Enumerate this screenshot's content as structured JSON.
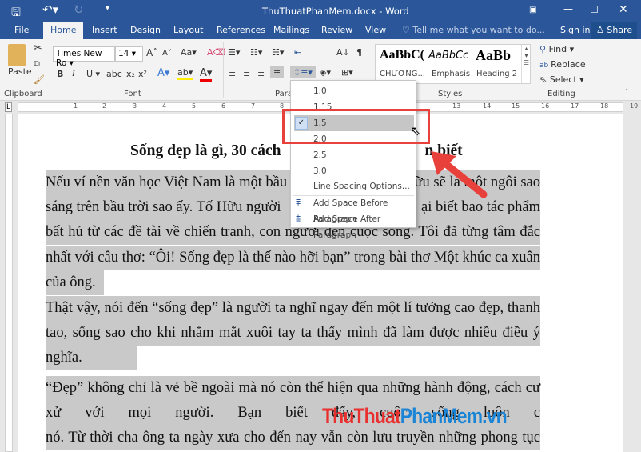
{
  "title": "ThuThuatPhanMem.docx - Word",
  "tabs": [
    "File",
    "Home",
    "Insert",
    "Design",
    "Layout",
    "References",
    "Mailings",
    "Review",
    "View"
  ],
  "tell_me": "Tell me what you want to do...",
  "sign_in": "Sign in",
  "share": "Share",
  "font": {
    "name": "Times New Ro",
    "size": "14"
  },
  "clipboard": {
    "paste": "Paste"
  },
  "styles": [
    {
      "preview": "AaBbC(",
      "name": "CHƯƠNG..."
    },
    {
      "preview": "AaBbCc",
      "name": "Emphasis"
    },
    {
      "preview": "AaBb",
      "name": "Heading 2"
    }
  ],
  "editing": {
    "find": "Find",
    "replace": "Replace",
    "select": "Select"
  },
  "groups": {
    "clipboard": "Clipboard",
    "font": "Font",
    "paragraph": "Parag",
    "styles": "Styles",
    "editing": "Editing"
  },
  "ruler": [
    "1",
    "2",
    "3",
    "4",
    "5",
    "6",
    "7",
    "8",
    "13",
    "14",
    "15",
    "16",
    "17",
    "18",
    "19"
  ],
  "menu": {
    "options": [
      "1.0",
      "1.15",
      "1.5",
      "2.0",
      "2.5",
      "3.0"
    ],
    "selected": "1.5",
    "line_spacing_options": "Line Spacing Options...",
    "add_before": "Add Space Before Paragraph",
    "add_after": "Add Space After Paragraph"
  },
  "doc": {
    "title_left": "Sống đẹp là gì, 30 cách",
    "title_right": "n biết",
    "lines": [
      {
        "l": "Nếu ví nền văn học Việt Nam là một bầu",
        "r": "ữu sẽ là một ngôi sao"
      },
      {
        "l": "sáng trên bầu trời sao ấy. Tố Hữu người",
        "r": "ại biết bao tác phẩm"
      },
      {
        "l": "bất hủ từ các đề tài về chiến tranh, con người đến cuộc sống. Tôi đã từng tâm đắc",
        "r": ""
      },
      {
        "l": "nhất với câu thơ:  “Ôi! Sống đẹp là thế nào hỡi bạn” trong bài thơ Một khúc ca xuân",
        "r": ""
      },
      {
        "l": "của ông.",
        "r": ""
      },
      {
        "l": "Thật vậy, nói đến “sống đẹp” là người ta nghĩ ngay đến một lí tưởng cao đẹp, thanh",
        "r": ""
      },
      {
        "l": "tao, sống sao cho khi nhắm mắt xuôi tay ta thấy mình đã làm được nhiều điều ý",
        "r": ""
      },
      {
        "l": "nghĩa.",
        "r": ""
      },
      {
        "l": "“Đẹp” không chỉ là vẻ bề ngoài mà nó còn thể hiện qua những hành động, cách cư",
        "r": ""
      },
      {
        "l": "xử với mọi người. Bạn biết đấy, cuộc sống luôn c",
        "r": ""
      },
      {
        "l": "nó. Từ thời cha ông ta ngày xưa cho đến nay vẫn còn lưu truyền những phong tục",
        "r": ""
      }
    ]
  },
  "watermark": {
    "a": "ThuThuat",
    "b": "PhanMem.vn"
  },
  "colors": {
    "accent": "#2b579a",
    "highlight_box": "#e8413c"
  }
}
